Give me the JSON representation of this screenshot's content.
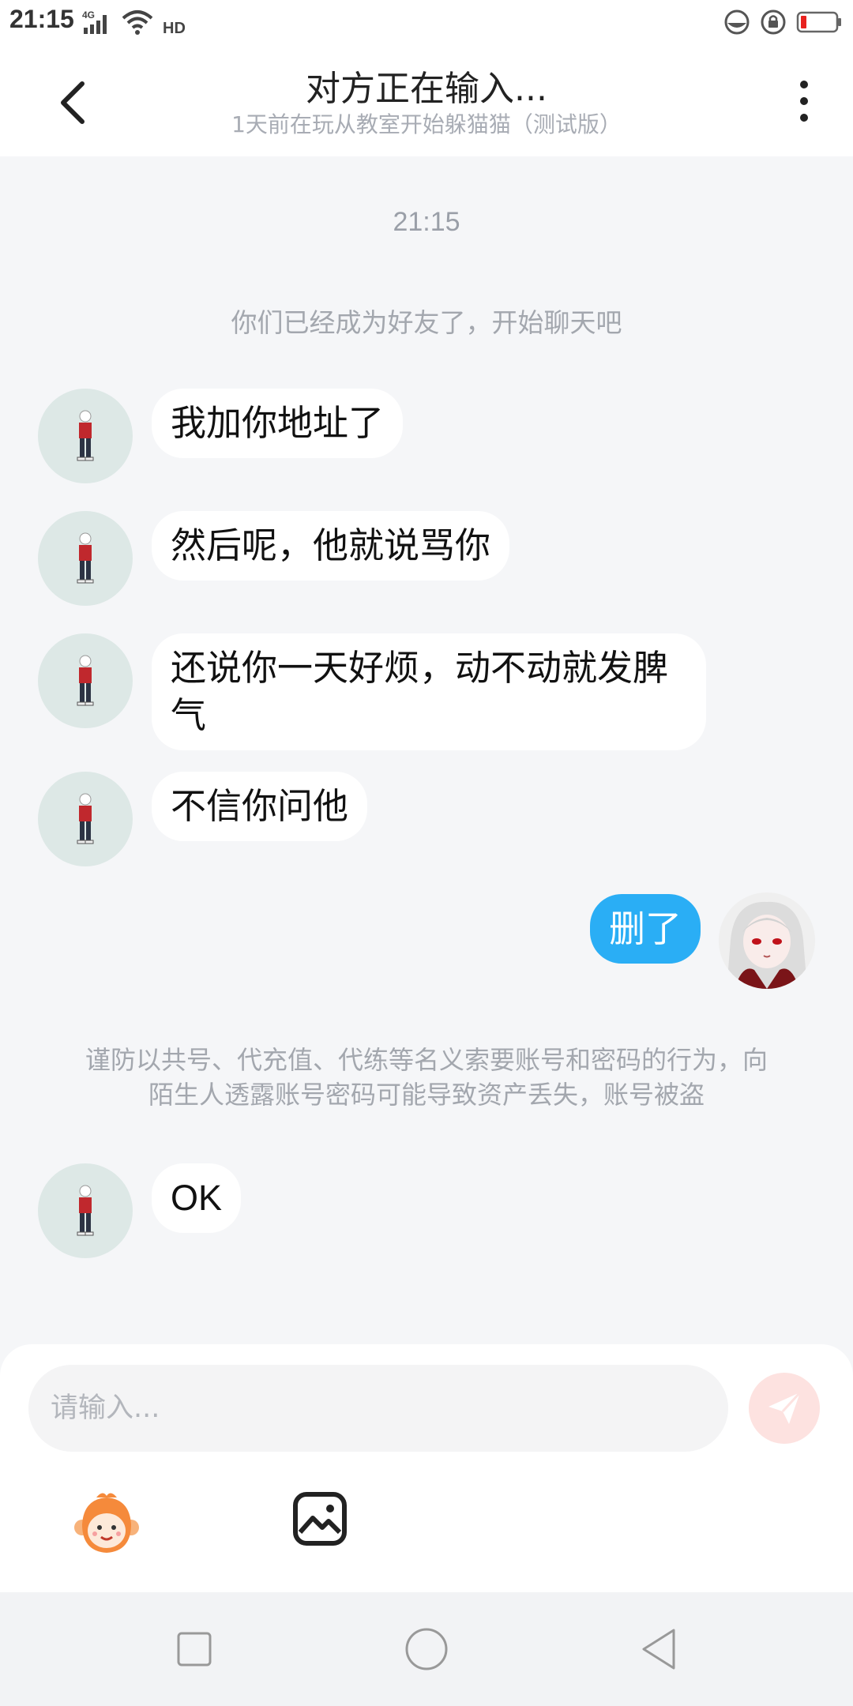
{
  "status_bar": {
    "time": "21:15",
    "network": "4G",
    "hd": "HD"
  },
  "header": {
    "title": "对方正在输入...",
    "subtitle": "1天前在玩从教室开始躲猫猫（测试版）"
  },
  "chat": {
    "time": "21:15",
    "system_note": "你们已经成为好友了，开始聊天吧",
    "messages": [
      {
        "side": "left",
        "text": "我加你地址了"
      },
      {
        "side": "left",
        "text": "然后呢，他就说骂你"
      },
      {
        "side": "left",
        "text": "还说你一天好烦，动不动就发脾气"
      },
      {
        "side": "left",
        "text": "不信你问他"
      },
      {
        "side": "right",
        "text": "删了"
      },
      {
        "side": "left",
        "text": "OK"
      }
    ],
    "warning_note": "谨防以共号、代充值、代练等名义索要账号和密码的行为，向陌生人透露账号密码可能导致资产丢失，账号被盗"
  },
  "input": {
    "placeholder": "请输入..."
  },
  "icons": {
    "back": "chevron-left-icon",
    "more": "more-vertical-icon",
    "send": "send-icon",
    "emoji": "monkey-emoji-icon",
    "image": "image-icon"
  },
  "colors": {
    "outgoing_bubble": "#2aaef5",
    "send_button": "#fde2e0",
    "background": "#f5f6f8"
  }
}
